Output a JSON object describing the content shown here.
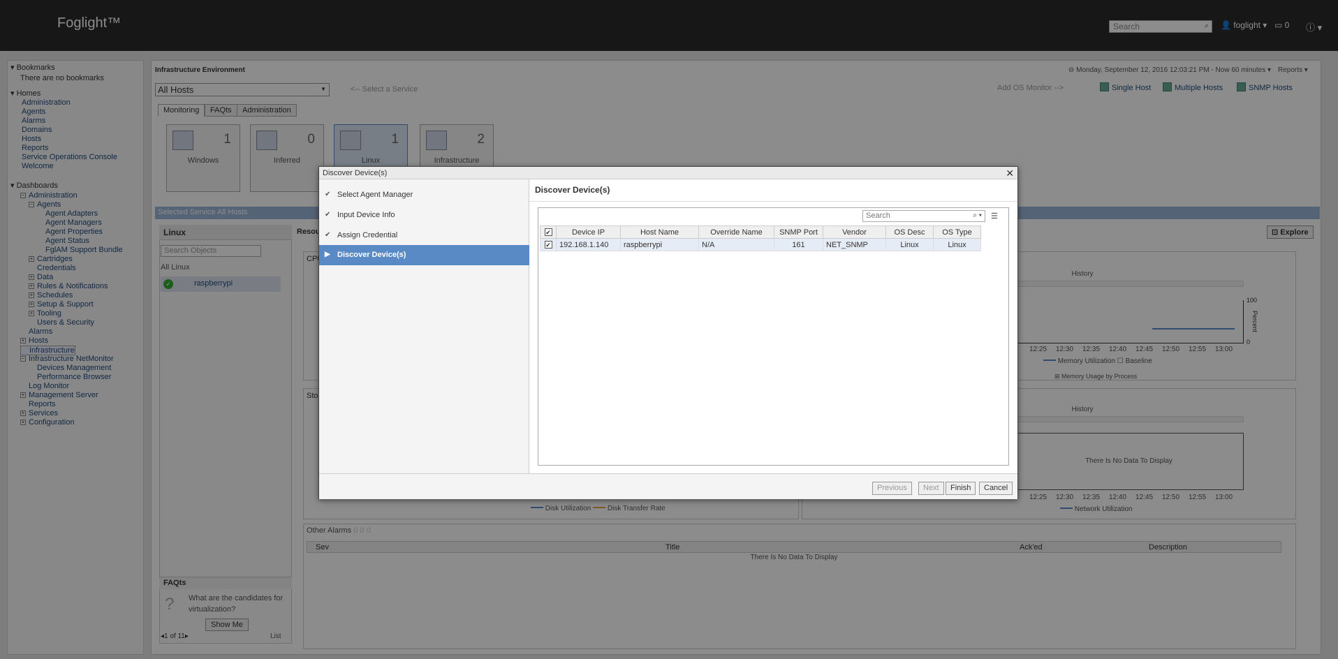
{
  "app": {
    "title": "Foglight™"
  },
  "topbar": {
    "search_placeholder": "Search",
    "user": "foglight ▾",
    "messages": "0",
    "info": "ⓘ ▾"
  },
  "sidebar": {
    "bookmarks_header": "Bookmarks",
    "bookmarks_empty": "There are no bookmarks",
    "homes_header": "Homes",
    "homes": [
      "Administration",
      "Agents",
      "Alarms",
      "Domains",
      "Hosts",
      "Reports",
      "Service Operations Console",
      "Welcome"
    ],
    "dashboards_header": "Dashboards",
    "tree": [
      {
        "label": "Administration",
        "level": 0,
        "box": "−"
      },
      {
        "label": "Agents",
        "level": 1,
        "box": "−"
      },
      {
        "label": "Agent Adapters",
        "level": 2
      },
      {
        "label": "Agent Managers",
        "level": 2
      },
      {
        "label": "Agent Properties",
        "level": 2
      },
      {
        "label": "Agent Status",
        "level": 2
      },
      {
        "label": "FglAM Support Bundle",
        "level": 2
      },
      {
        "label": "Cartridges",
        "level": 1,
        "box": "+"
      },
      {
        "label": "Credentials",
        "level": 1
      },
      {
        "label": "Data",
        "level": 1,
        "box": "+"
      },
      {
        "label": "Rules & Notifications",
        "level": 1,
        "box": "+"
      },
      {
        "label": "Schedules",
        "level": 1,
        "box": "+"
      },
      {
        "label": "Setup & Support",
        "level": 1,
        "box": "+"
      },
      {
        "label": "Tooling",
        "level": 1,
        "box": "+"
      },
      {
        "label": "Users & Security",
        "level": 1
      },
      {
        "label": "Alarms",
        "level": 0
      },
      {
        "label": "Hosts",
        "level": 0,
        "box": "+"
      },
      {
        "label": "Infrastructure",
        "level": 0,
        "selected": true
      },
      {
        "label": "Infrastructure NetMonitor",
        "level": 0,
        "box": "−"
      },
      {
        "label": "Devices Management",
        "level": 1
      },
      {
        "label": "Performance Browser",
        "level": 1
      },
      {
        "label": "Log Monitor",
        "level": 0
      },
      {
        "label": "Management Server",
        "level": 0,
        "box": "+"
      },
      {
        "label": "Reports",
        "level": 0
      },
      {
        "label": "Services",
        "level": 0,
        "box": "+"
      },
      {
        "label": "Configuration",
        "level": 0,
        "box": "+"
      }
    ]
  },
  "main": {
    "env_title": "Infrastructure Environment",
    "host_select": "All Hosts",
    "select_service_hint": "<-- Select a Service",
    "timebar": "⊖ Monday, September 12, 2016 12:03:21 PM - Now 60 minutes ▾",
    "reports": "Reports ▾",
    "add_os_monitor": "Add OS Monitor -->",
    "host_buttons": [
      "Single Host",
      "Multiple Hosts",
      "SNMP Hosts"
    ],
    "tabs": [
      "Monitoring",
      "FAQts",
      "Administration"
    ],
    "tiles": [
      {
        "label": "Windows",
        "count": "1"
      },
      {
        "label": "Inferred",
        "count": "0"
      },
      {
        "label": "Linux",
        "count": "1"
      },
      {
        "label": "Infrastructure",
        "count": "2"
      }
    ],
    "selected_service": "Selected Service All Hosts",
    "left_panel_title": "Linux",
    "search_objects": "Search Objects",
    "all_linux": "All Linux",
    "host_item": "raspberrypi",
    "faqs_title": "FAQts",
    "faq_question": "What are the candidates for virtualization?",
    "show_me": "Show Me",
    "pager": "1 of 11",
    "list_label": "List",
    "explore": "Explore",
    "resources_label": "Resou",
    "cpu_label": "CPU",
    "storage_label": "Sto",
    "history_label": "History",
    "percent_label": "Percent",
    "max_tick": "100",
    "min_tick": "0",
    "time_ticks": [
      "12:25",
      "12:30",
      "12:35",
      "12:40",
      "12:45",
      "12:50",
      "12:55",
      "13:00"
    ],
    "memory_legend": "Memory  Utilization",
    "baseline_legend": "Baseline",
    "memory_by_process": "Memory Usage by Process",
    "no_data": "There Is No Data To Display",
    "disk_util": "Disk Utilization",
    "disk_transfer": "Disk Transfer Rate",
    "network_util": "Network Utilization",
    "other_alarms": "Other Alarms",
    "other_alarm_counts": "0  0  0",
    "alarm_cols": [
      "Sev",
      "Title",
      "Ack'ed",
      "Description"
    ]
  },
  "dialog": {
    "title": "Discover Device(s)",
    "steps": [
      {
        "label": "Select Agent Manager",
        "state": "done"
      },
      {
        "label": "Input Device Info",
        "state": "done"
      },
      {
        "label": "Assign Credential",
        "state": "done"
      },
      {
        "label": "Discover Device(s)",
        "state": "active"
      }
    ],
    "content_title": "Discover Device(s)",
    "search_placeholder": "Search",
    "columns": [
      "Device IP",
      "Host Name",
      "Override Name",
      "SNMP Port",
      "Vendor",
      "OS Desc",
      "OS Type"
    ],
    "rows": [
      {
        "checked": true,
        "cells": [
          "192.168.1.140",
          "raspberrypi",
          "N/A",
          "161",
          "NET_SNMP",
          "Linux",
          "Linux"
        ]
      }
    ],
    "buttons": {
      "previous": "Previous",
      "next": "Next",
      "finish": "Finish",
      "cancel": "Cancel"
    }
  },
  "colors": {
    "accent": "#5a8ac6",
    "topbar": "#2a2a2a",
    "memory_line": "#5a8ac6",
    "disk_transfer": "#e8a040"
  }
}
